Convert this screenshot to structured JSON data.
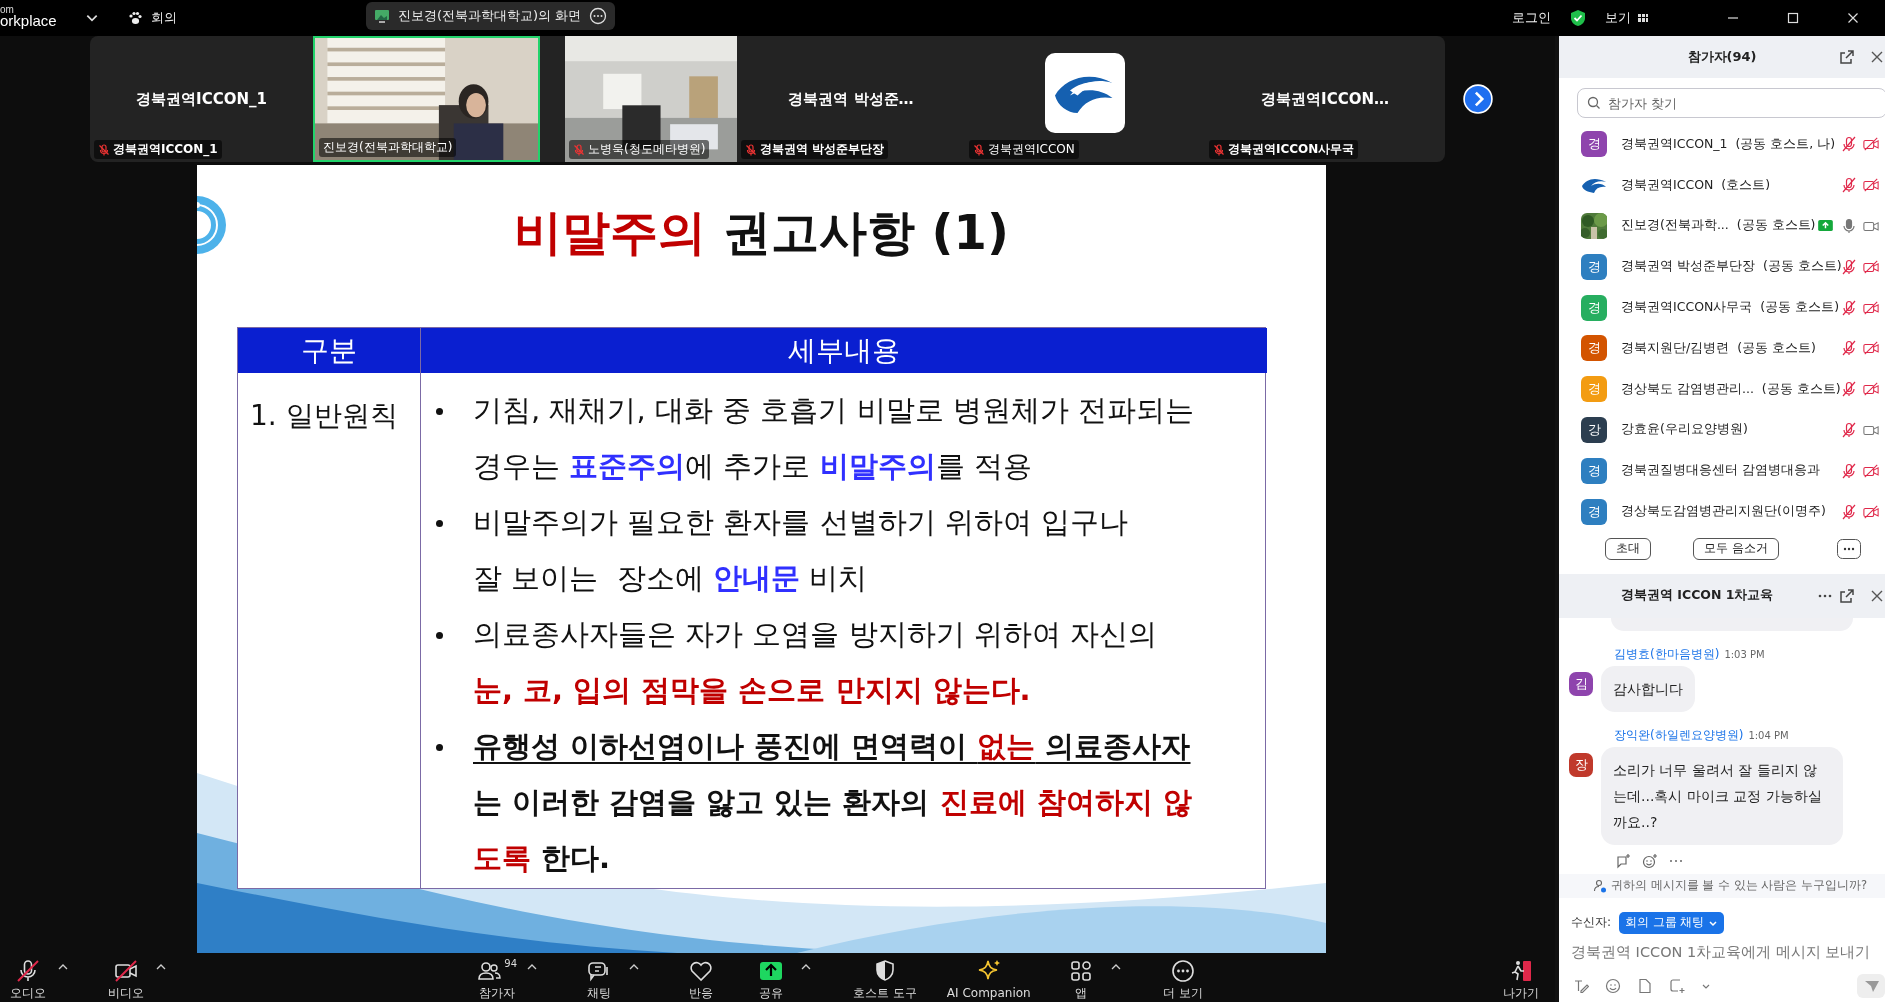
{
  "top_bar": {
    "app_name_top": "om",
    "app_name": "orkplace",
    "meeting_label": "회의",
    "share_title": "진보경(전북과학대학교)의 화면",
    "sign_in": "로그인",
    "view": "보기"
  },
  "video_strip": {
    "tiles": [
      {
        "kind": "name",
        "name": "경북권역ICCON_1",
        "label": "경북권역ICCON_1",
        "muted": true,
        "speaking": false
      },
      {
        "kind": "video",
        "label": "진보경(전북과학대학교)",
        "muted": false,
        "speaking": true
      },
      {
        "kind": "video",
        "label": "노병욱(청도메타병원)",
        "muted": true,
        "speaking": false
      },
      {
        "kind": "name",
        "name": "경북권역 박성준…",
        "label": "경북권역 박성준부단장",
        "muted": true,
        "speaking": false
      },
      {
        "kind": "logo",
        "label": "경북권역ICCON",
        "muted": true,
        "speaking": false
      },
      {
        "kind": "name",
        "name": "경북권역ICCON…",
        "label": "경북권역ICCON사무국",
        "muted": true,
        "speaking": false
      }
    ]
  },
  "slide": {
    "title": [
      {
        "text": "비말주의",
        "kind": "red"
      },
      {
        "text": " 권고사항 (1)",
        "kind": "plain"
      }
    ],
    "table": {
      "columns": [
        "구분",
        "세부내용"
      ],
      "rows": [
        {
          "category": "1. 일반원칙",
          "bullets": [
            {
              "bold": false,
              "lines": [
                [
                  {
                    "text": "기침, 재채기, 대화 중 호흡기 비말로 병원체가 전파되는",
                    "kind": "plain"
                  }
                ],
                [
                  {
                    "text": "경우는 ",
                    "kind": "plain"
                  },
                  {
                    "text": "표준주의",
                    "kind": "blue"
                  },
                  {
                    "text": "에 추가로 ",
                    "kind": "plain"
                  },
                  {
                    "text": "비말주의",
                    "kind": "blue"
                  },
                  {
                    "text": "를 적용",
                    "kind": "plain"
                  }
                ]
              ]
            },
            {
              "bold": false,
              "lines": [
                [
                  {
                    "text": "비말주의가 필요한 환자를 선별하기 위하여 입구나",
                    "kind": "plain"
                  }
                ],
                [
                  {
                    "text": "잘 보이는  장소에 ",
                    "kind": "plain"
                  },
                  {
                    "text": "안내문",
                    "kind": "blue"
                  },
                  {
                    "text": " 비치",
                    "kind": "plain"
                  }
                ]
              ]
            },
            {
              "bold": false,
              "lines": [
                [
                  {
                    "text": "의료종사자들은 자가 오염을 방지하기 위하여 자신의",
                    "kind": "plain"
                  }
                ],
                [
                  {
                    "text": "눈, 코, 입의 점막을 손으로 만지지 않는다.",
                    "kind": "red"
                  }
                ]
              ]
            },
            {
              "bold": true,
              "lines": [
                [
                  {
                    "text": "유행성 이하선염이나 풍진에 면역력이 ",
                    "kind": "underline"
                  },
                  {
                    "text": "없는",
                    "kind": "red-underline"
                  },
                  {
                    "text": " 의료종사자",
                    "kind": "underline"
                  }
                ],
                [
                  {
                    "text": "는 이러한 감염을 앓고 있는 환자의 ",
                    "kind": "plain"
                  },
                  {
                    "text": "진료에 참여하지 않",
                    "kind": "red"
                  }
                ],
                [
                  {
                    "text": "도록",
                    "kind": "red"
                  },
                  {
                    "text": " 한다.",
                    "kind": "plain"
                  }
                ]
              ]
            }
          ]
        }
      ]
    }
  },
  "toolbar": {
    "items": [
      {
        "kind": "mic",
        "label": "오디오",
        "slashed": true,
        "caret": true
      },
      {
        "kind": "video",
        "label": "비디오",
        "slashed": true,
        "caret": true
      },
      {
        "kind": "participants",
        "label": "참가자",
        "count": "94",
        "caret": true
      },
      {
        "kind": "chat",
        "label": "채팅",
        "caret": true
      },
      {
        "kind": "reactions",
        "label": "반응",
        "caret": false
      },
      {
        "kind": "share",
        "label": "공유",
        "caret": true
      },
      {
        "kind": "host",
        "label": "호스트 도구",
        "caret": false
      },
      {
        "kind": "ai",
        "label": "AI Companion",
        "caret": false
      },
      {
        "kind": "apps",
        "label": "앱",
        "caret": true
      },
      {
        "kind": "more",
        "label": "더 보기",
        "caret": false
      },
      {
        "kind": "leave",
        "label": "나가기",
        "caret": false
      }
    ]
  },
  "participants_panel": {
    "title": "참가자(94)",
    "search_placeholder": "참가자 찾기",
    "participants": [
      {
        "name": "경북권역ICCON_1",
        "role": "(공동 호스트, 나)",
        "avatar": {
          "kind": "letter",
          "letter": "경",
          "color": "#8e44ad"
        },
        "mic_muted": true,
        "video_off": true,
        "sharing": false
      },
      {
        "name": "경북권역ICCON",
        "role": "(호스트)",
        "avatar": {
          "kind": "logo"
        },
        "mic_muted": true,
        "video_off": true,
        "sharing": false
      },
      {
        "name": "진보경(전북과학...",
        "role": "(공동 호스트)",
        "mic_muted": false,
        "video_off": false,
        "sharing": true
      },
      {
        "name": "경북권역 박성준부단장",
        "role": "(공동 호스트)",
        "avatar": {
          "kind": "letter",
          "letter": "경",
          "color": "#2e7fc0"
        },
        "mic_muted": true,
        "video_off": true,
        "sharing": false
      },
      {
        "name": "경북권역ICCON사무국",
        "role": "(공동 호스트)",
        "avatar": {
          "kind": "letter",
          "letter": "경",
          "color": "#27ae60"
        },
        "mic_muted": true,
        "video_off": true,
        "sharing": false
      },
      {
        "name": "경북지원단/김병련",
        "role": "(공동 호스트)",
        "avatar": {
          "kind": "letter",
          "letter": "경",
          "color": "#d35400"
        },
        "mic_muted": true,
        "video_off": true,
        "sharing": false
      },
      {
        "name": "경상북도 감염병관리...",
        "role": "(공동 호스트)",
        "avatar": {
          "kind": "letter",
          "letter": "경",
          "color": "#f39c12"
        },
        "mic_muted": true,
        "video_off": true,
        "sharing": false
      },
      {
        "name": "강효윤(우리요양병원)",
        "avatar": {
          "kind": "letter",
          "letter": "강",
          "color": "#2c3e50"
        },
        "mic_muted": true,
        "video_off": false,
        "sharing": false
      },
      {
        "name": "경북권질병대응센터 감염병대응과",
        "avatar": {
          "kind": "letter",
          "letter": "경",
          "color": "#2e7fc0"
        },
        "mic_muted": true,
        "video_off": true,
        "sharing": false
      },
      {
        "name": "경상북도감염병관리지원단(이명주)",
        "avatar": {
          "kind": "letter",
          "letter": "경",
          "color": "#2e7fc0"
        },
        "mic_muted": true,
        "video_off": true,
        "sharing": false
      }
    ],
    "buttons": [
      "초대",
      "모두 음소거"
    ]
  },
  "chat": {
    "title": "경북권역 ICCON 1차교육",
    "messages": [
      {
        "sender": "김병효(한마음병원)",
        "time": "1:03 PM",
        "text": "감사합니다",
        "avatar": "김",
        "color": "#8e44ad"
      },
      {
        "sender": "장익완(하일렌요양병원)",
        "time": "1:04 PM",
        "text": "소리가 너무 울려서 잘 들리지 않는데...혹시 마이크 교정 가능하실까요..?",
        "avatar": "장",
        "color": "#c0392b"
      }
    ],
    "visibility_note": "귀하의 메시지를 볼 수 있는 사람은 누구입니까?",
    "recipient_label": "수신자:",
    "recipient": "회의 그룹 채팅",
    "placeholder": "경북권역 ICCON 1차교육에게 메시지 보내기"
  }
}
